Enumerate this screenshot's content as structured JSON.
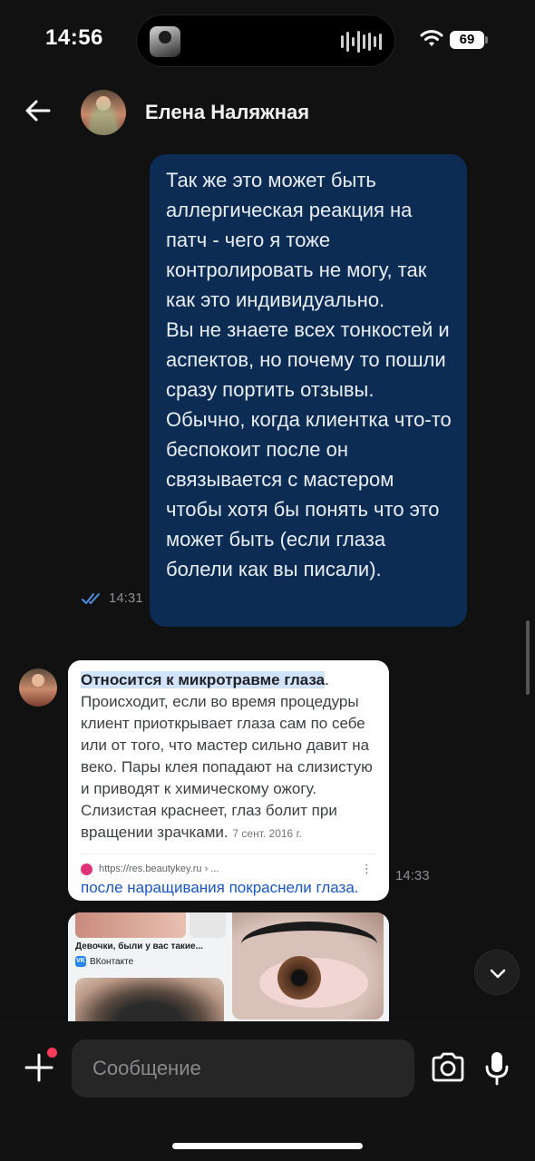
{
  "status_bar": {
    "time": "14:56",
    "battery": "69"
  },
  "header": {
    "contact_name": "Елена Наляжная"
  },
  "messages": {
    "outgoing": {
      "text": "Так же это может быть аллергическая реакция на патч - чего я тоже контролировать не могу, так как это индивидуально.\nВы не знаете всех тонкостей и аспектов, но почему то пошли сразу портить отзывы. Обычно, когда клиентка что-то беспокоит после он связывается с мастером чтобы хотя бы понять что это может быть (если глаза болели как вы писали).",
      "time": "14:31",
      "status": "read",
      "bubble_color": "#0c2c53"
    },
    "incoming": {
      "time": "14:33",
      "card1": {
        "title_highlight": "Относится к микротравме глаза",
        "title_rest": ".",
        "body": "Происходит, если во время процедуры клиент приоткрывает глаза сам по себе или от того, что мастер сильно давит на веко. Пары клея попадают на слизистую и приводят к химическому ожогу. Слизистая краснеет, глаз болит при вращении зрачками.",
        "date": "7 сент. 2016 г.",
        "source_url": "https://res.beautykey.ru › ...",
        "link_text": "после наращивания покраснели глаза."
      },
      "card2": {
        "caption": "Девочки, были у вас такие...",
        "source": "ВКонтакте",
        "source_icon_text": "VK"
      }
    }
  },
  "composer": {
    "placeholder": "Сообщение"
  },
  "icons": {
    "back": "arrow-left-icon",
    "plus": "plus-icon",
    "camera": "camera-icon",
    "mic": "microphone-icon",
    "scroll_down": "chevron-down-icon",
    "read": "double-check-icon",
    "wifi": "wifi-icon"
  },
  "colors": {
    "background": "#111111",
    "outgoing_bubble": "#0c2c53",
    "link": "#1a56c5",
    "notification_dot": "#ff3b5c"
  }
}
